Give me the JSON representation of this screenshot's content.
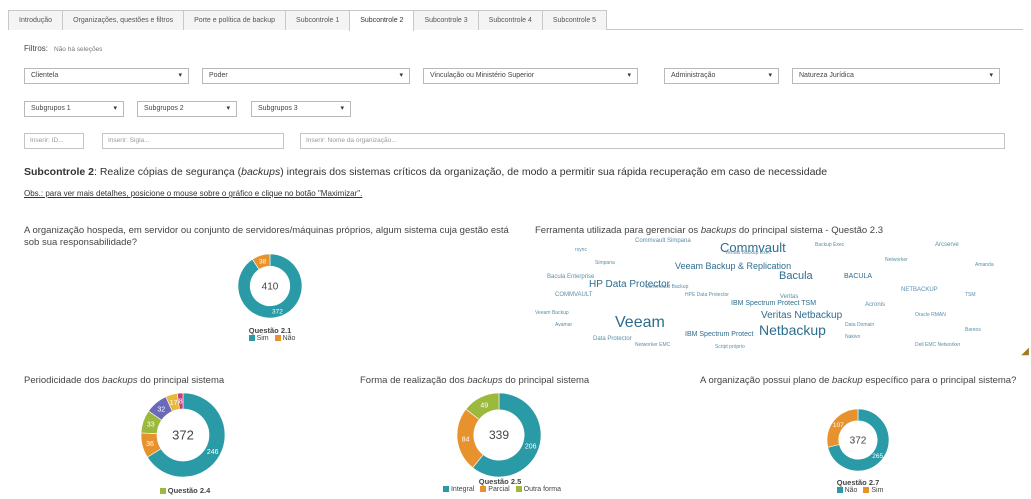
{
  "tabs": [
    {
      "label": "Introdução"
    },
    {
      "label": "Organizações, questões e filtros"
    },
    {
      "label": "Porte e política de backup"
    },
    {
      "label": "Subcontrole 1"
    },
    {
      "label": "Subcontrole 2",
      "active": true
    },
    {
      "label": "Subcontrole 3"
    },
    {
      "label": "Subcontrole 4"
    },
    {
      "label": "Subcontrole 5"
    }
  ],
  "filters": {
    "label": "Filtros:",
    "value": "Não há seleções"
  },
  "selects": {
    "clientela": "Clientela",
    "poder": "Poder",
    "vinculacao": "Vinculação ou Ministério Superior",
    "administracao": "Administração",
    "natureza": "Natureza Jurídica",
    "subgrupos1": "Subgrupos 1",
    "subgrupos2": "Subgrupos 2",
    "subgrupos3": "Subgrupos 3"
  },
  "inputs": {
    "id_placeholder": "Inserir: ID...",
    "sigla_placeholder": "Inserir: Sigla...",
    "nome_placeholder": "Inserir: Nome da organização..."
  },
  "heading": {
    "bold": "Subcontrole 2",
    "text_a": ": Realize cópias de segurança (",
    "text_b": "backups",
    "text_c": ") integrais dos sistemas críticos da organização, de modo a permitir sua rápida recuperação em caso de necessidade"
  },
  "obs": "Obs.: para ver mais detalhes, posicione o mouse sobre o gráfico e clique no botão \"Maximizar\".",
  "q21": {
    "title": "A organização hospeda, em servidor ou conjunto de servidores/máquinas próprios, algum sistema cuja gestão está sob sua responsabilidade?",
    "name": "Questão 2.1",
    "total": "410",
    "slices": [
      {
        "label": "Sim",
        "value": 372,
        "color": "#2a9aa6"
      },
      {
        "label": "Não",
        "value": 38,
        "color": "#e8922d"
      }
    ]
  },
  "q23": {
    "title_a": "Ferramenta utilizada para gerenciar os ",
    "title_b": "backups",
    "title_c": " do principal sistema - Questão 2.3",
    "words": [
      "Commvault",
      "Veeam Backup & Replication",
      "Bacula",
      "HP Data Protector",
      "Veritas Netbackup",
      "Veeam",
      "Netbackup",
      "IBM Spectrum Protect",
      "Data Protector",
      "BACULA",
      "NETBACKUP",
      "IBM Spectrum Protect TSM",
      "Commvault Simpana",
      "Arcserve",
      "Acronis",
      "COMMVAULT",
      "Veritas",
      "Bacula Enterprise",
      "Networker",
      "Backup Exec",
      "Amanda",
      "rsync",
      "Avamar",
      "Networker EMC",
      "Veeam Backup",
      "Data Domain",
      "Oracle RMAN",
      "Commvault Backup",
      "Simpana",
      "TSM",
      "Bareos",
      "Nakivo",
      "Script próprio",
      "HPE Data Protector",
      "Dell EMC Networker",
      "Veritas Backup Exec"
    ]
  },
  "q24": {
    "title_a": "Periodicidade dos ",
    "title_b": "backups",
    "title_c": " do principal sistema",
    "name": "Questão 2.4",
    "total": "372",
    "slices": [
      {
        "value": 246,
        "color": "#2a9aa6"
      },
      {
        "value": 36,
        "color": "#e8922d"
      },
      {
        "value": 33,
        "color": "#9bb93c"
      },
      {
        "value": 32,
        "color": "#6a6ab8"
      },
      {
        "value": 17,
        "color": "#e7b83a"
      },
      {
        "value": 8,
        "color": "#c53d7e"
      }
    ]
  },
  "q25": {
    "title_a": "Forma de realização dos ",
    "title_b": "backups",
    "title_c": " do principal sistema",
    "name": "Questão 2.5",
    "total": "339",
    "slices": [
      {
        "label": "Integral",
        "value": 206,
        "color": "#2a9aa6"
      },
      {
        "label": "Parcial",
        "value": 84,
        "color": "#e8922d"
      },
      {
        "label": "Outra forma",
        "value": 49,
        "color": "#9bb93c"
      }
    ]
  },
  "q27": {
    "title_a": "A organização possui plano de ",
    "title_b": "backup",
    "title_c": " específico para o principal sistema?",
    "name": "Questão 2.7",
    "total": "372",
    "slices": [
      {
        "label": "Não",
        "value": 265,
        "color": "#2a9aa6"
      },
      {
        "label": "Sim",
        "value": 107,
        "color": "#e8922d"
      }
    ]
  }
}
